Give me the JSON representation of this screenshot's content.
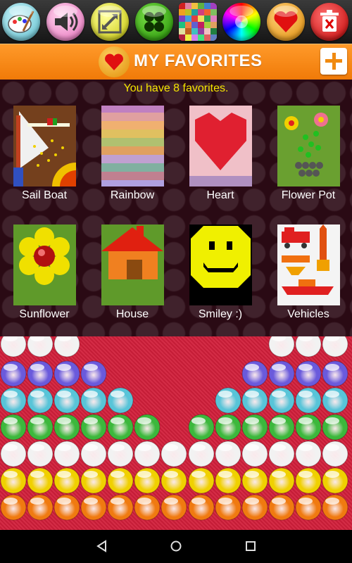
{
  "header": {
    "title": "MY FAVORITES"
  },
  "favorites": {
    "count_text": "You have 8 favorites.",
    "items": [
      {
        "label": "Sail Boat"
      },
      {
        "label": "Rainbow"
      },
      {
        "label": "Heart"
      },
      {
        "label": "Flower Pot"
      },
      {
        "label": "Sunflower"
      },
      {
        "label": "House"
      },
      {
        "label": "Smiley :)"
      },
      {
        "label": "Vehicles"
      }
    ]
  },
  "toolbar": {
    "buttons": [
      {
        "icon": "paint-palette-icon",
        "color": "#8fd6e0"
      },
      {
        "icon": "speaker-icon",
        "color": "#f58ccc"
      },
      {
        "icon": "resize-icon",
        "color": "#e6e600"
      },
      {
        "icon": "four-circles-icon",
        "color": "#33b800"
      },
      {
        "icon": "color-grid-icon",
        "color": "#c04080"
      },
      {
        "icon": "color-wheel-icon",
        "color": "#c040c0"
      },
      {
        "icon": "heart-icon",
        "color": "#f0a020"
      },
      {
        "icon": "trash-icon",
        "color": "#e02020"
      }
    ]
  },
  "bubble_colors": {
    "purple": "#6a5adc",
    "cyan": "#58c4d8",
    "green": "#3cb83c",
    "white": "#f2f2f2",
    "yellow": "#f0d000",
    "orange": "#f07a10",
    "background": "#d11f3a"
  },
  "nav": {
    "icons": [
      "back-icon",
      "home-icon",
      "recents-icon"
    ]
  }
}
